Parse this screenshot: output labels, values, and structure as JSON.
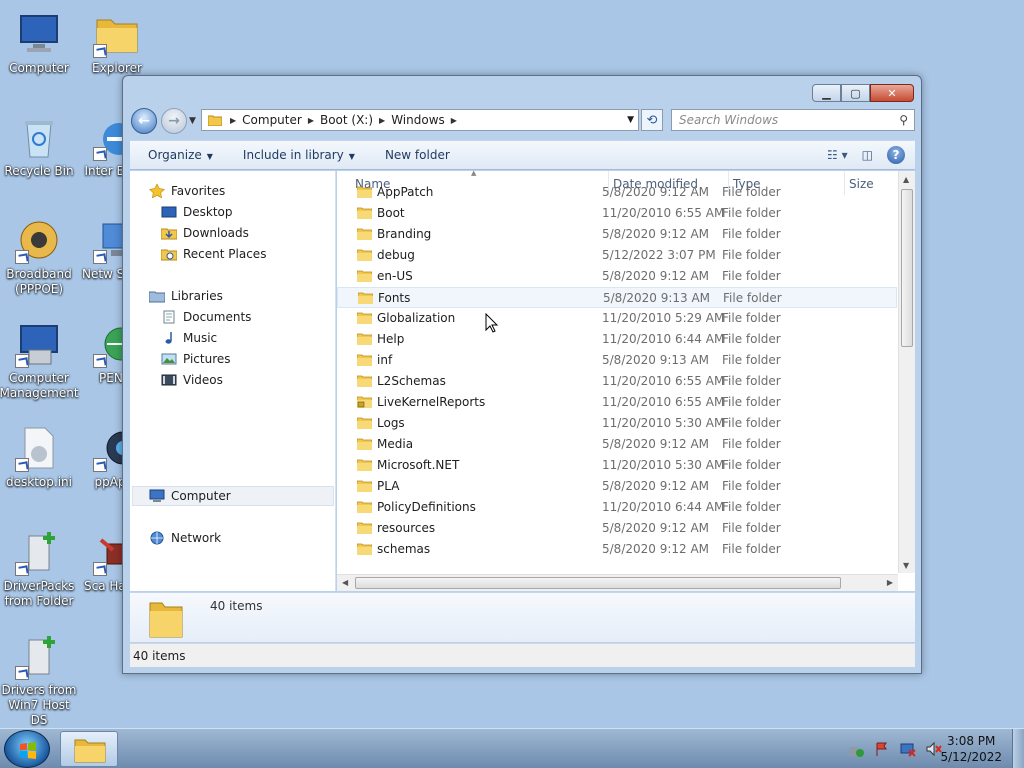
{
  "desktop": {
    "icons": [
      {
        "label": "Computer",
        "icon": "computer-icon"
      },
      {
        "label": "Explorer",
        "icon": "explorer-icon"
      },
      {
        "label": "Recycle Bin",
        "icon": "recycle-bin-icon"
      },
      {
        "label": "Inter Explo",
        "icon": "internet-explorer-icon"
      },
      {
        "label": "Broadband (PPPOE)",
        "icon": "broadband-icon"
      },
      {
        "label": "Netw Settin",
        "icon": "network-settings-icon"
      },
      {
        "label": "Computer Management",
        "icon": "computer-management-icon"
      },
      {
        "label": "PENet",
        "icon": "penet-icon"
      },
      {
        "label": "desktop.ini",
        "icon": "ini-file-icon"
      },
      {
        "label": "ppApps",
        "icon": "ppapps-icon"
      },
      {
        "label": "DriverPacks from Folder",
        "icon": "driverpacks-icon"
      },
      {
        "label": "Sca HardW",
        "icon": "scan-hardware-icon"
      },
      {
        "label": "Drivers from Win7 Host DS",
        "icon": "drivers-host-icon"
      }
    ]
  },
  "window": {
    "address": {
      "crumbs": [
        "Computer",
        "Boot (X:)",
        "Windows"
      ]
    },
    "search_placeholder": "Search Windows",
    "toolbar": {
      "organize": "Organize",
      "include": "Include in library",
      "new_folder": "New folder"
    },
    "nav": {
      "favorites": "Favorites",
      "desktop": "Desktop",
      "downloads": "Downloads",
      "recent": "Recent Places",
      "libraries": "Libraries",
      "documents": "Documents",
      "music": "Music",
      "pictures": "Pictures",
      "videos": "Videos",
      "computer": "Computer",
      "network": "Network"
    },
    "columns": {
      "name": "Name",
      "date": "Date modified",
      "type": "Type",
      "size": "Size"
    },
    "files": [
      {
        "name": "AppPatch",
        "date": "5/8/2020 9:12 AM",
        "type": "File folder"
      },
      {
        "name": "Boot",
        "date": "11/20/2010 6:55 AM",
        "type": "File folder"
      },
      {
        "name": "Branding",
        "date": "5/8/2020 9:12 AM",
        "type": "File folder"
      },
      {
        "name": "debug",
        "date": "5/12/2022 3:07 PM",
        "type": "File folder"
      },
      {
        "name": "en-US",
        "date": "5/8/2020 9:12 AM",
        "type": "File folder"
      },
      {
        "name": "Fonts",
        "date": "5/8/2020 9:13 AM",
        "type": "File folder"
      },
      {
        "name": "Globalization",
        "date": "11/20/2010 5:29 AM",
        "type": "File folder"
      },
      {
        "name": "Help",
        "date": "11/20/2010 6:44 AM",
        "type": "File folder"
      },
      {
        "name": "inf",
        "date": "5/8/2020 9:13 AM",
        "type": "File folder"
      },
      {
        "name": "L2Schemas",
        "date": "11/20/2010 6:55 AM",
        "type": "File folder"
      },
      {
        "name": "LiveKernelReports",
        "date": "11/20/2010 6:55 AM",
        "type": "File folder",
        "locked": true
      },
      {
        "name": "Logs",
        "date": "11/20/2010 5:30 AM",
        "type": "File folder"
      },
      {
        "name": "Media",
        "date": "5/8/2020 9:12 AM",
        "type": "File folder"
      },
      {
        "name": "Microsoft.NET",
        "date": "11/20/2010 5:30 AM",
        "type": "File folder"
      },
      {
        "name": "PLA",
        "date": "5/8/2020 9:12 AM",
        "type": "File folder"
      },
      {
        "name": "PolicyDefinitions",
        "date": "11/20/2010 6:44 AM",
        "type": "File folder"
      },
      {
        "name": "resources",
        "date": "5/8/2020 9:12 AM",
        "type": "File folder"
      },
      {
        "name": "schemas",
        "date": "5/8/2020 9:12 AM",
        "type": "File folder"
      }
    ],
    "hovered_file": "Fonts",
    "details_count": "40 items",
    "status_count": "40 items"
  },
  "taskbar": {
    "time": "3:08 PM",
    "date": "5/12/2022"
  },
  "colors": {
    "desktop_bg": "#a9c6e6",
    "folder_yellow": "#f2c84b",
    "accent_blue": "#2a5aa5"
  }
}
